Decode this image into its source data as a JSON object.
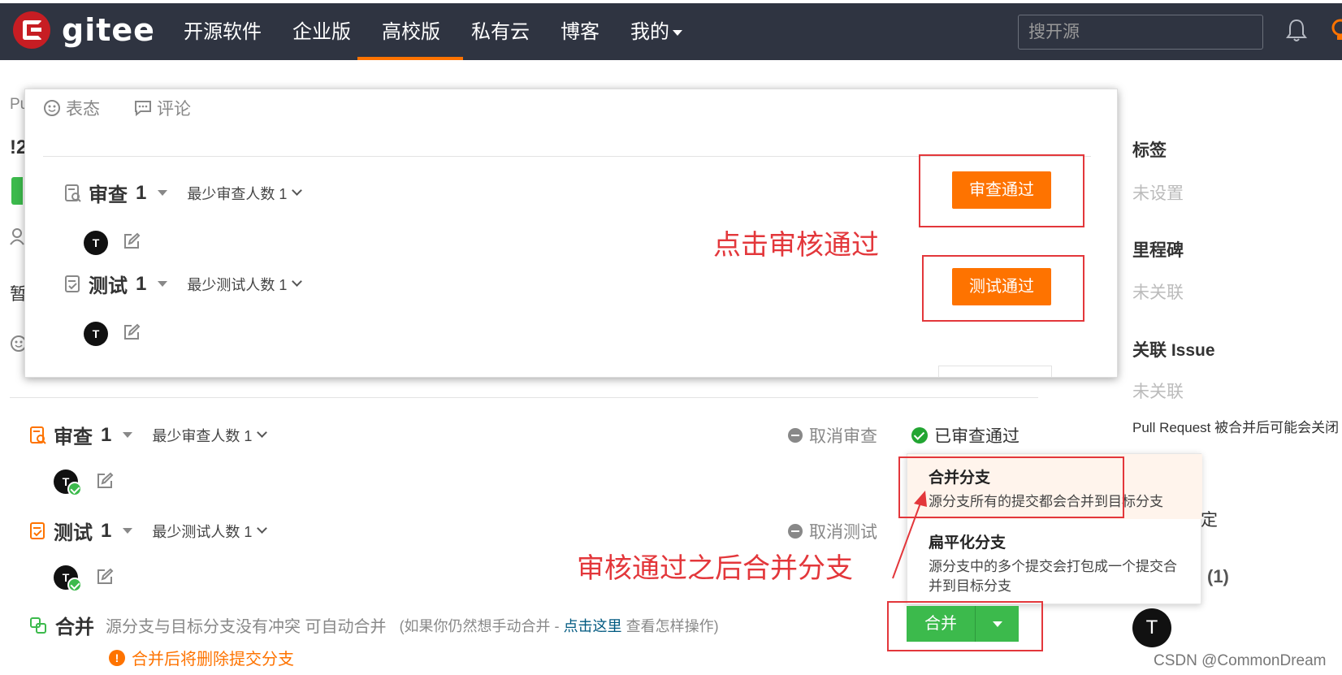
{
  "header": {
    "logo_text": "gitee",
    "nav": [
      "开源软件",
      "企业版",
      "高校版",
      "私有云",
      "博客",
      "我的"
    ],
    "search_placeholder": "搜开源"
  },
  "left_fragments": [
    "Pu",
    "!2",
    "暂"
  ],
  "modal": {
    "tabs": [
      "表态",
      "评论"
    ],
    "review": {
      "title": "审查",
      "count": "1",
      "min_label": "最少审查人数 1",
      "button": "审查通过"
    },
    "test": {
      "title": "测试",
      "count": "1",
      "min_label": "最少测试人数 1",
      "button": "测试通过"
    },
    "avatar_letter": "T"
  },
  "annotations": {
    "click_review": "点击审核通过",
    "after_review": "审核通过之后合并分支"
  },
  "page": {
    "review": {
      "title": "审查",
      "count": "1",
      "min_label": "最少审查人数 1",
      "cancel": "取消审查",
      "status": "已审查通过"
    },
    "test": {
      "title": "测试",
      "count": "1",
      "min_label": "最少测试人数 1",
      "cancel": "取消测试"
    },
    "avatar_letter": "T",
    "merge": {
      "title": "合并",
      "desc": "源分支与目标分支没有冲突 可自动合并",
      "hint_prefix": "(如果你仍然想手动合并 - ",
      "hint_link": "点击这里",
      "hint_suffix": " 查看怎样操作)",
      "warning": "合并后将删除提交分支",
      "button": "合并"
    },
    "dropdown": [
      {
        "title": "合并分支",
        "desc": "源分支所有的提交都会合并到目标分支"
      },
      {
        "title": "扁平化分支",
        "desc": "源分支中的多个提交会打包成一个提交合并到目标分支"
      }
    ]
  },
  "sidebar": {
    "labels_title": "标签",
    "labels_value": "未设置",
    "milestone_title": "里程碑",
    "milestone_value": "未关联",
    "issue_title": "关联 Issue",
    "issue_value": "未关联",
    "note": "Pull Request 被合并后可能会关闭",
    "frag": "定",
    "count": "(1)",
    "avatar_letter": "T"
  },
  "watermark": "CSDN @CommonDream",
  "colors": {
    "header_bg": "#2f3441",
    "accent": "#fe7300",
    "success": "#3cba4c",
    "annotation_red": "#e3373b"
  }
}
